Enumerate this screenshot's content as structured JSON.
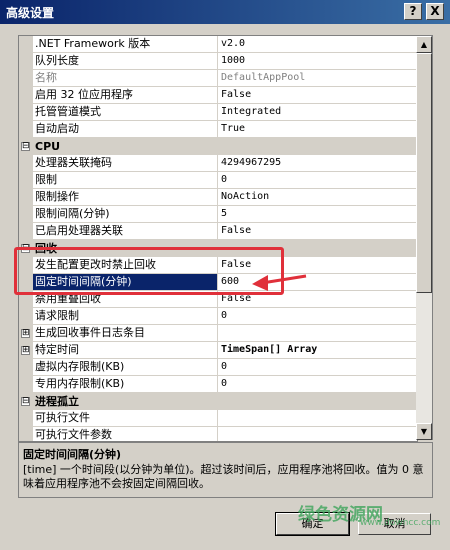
{
  "window": {
    "title": "高级设置",
    "help_glyph": "?",
    "close_glyph": "X"
  },
  "groups": {
    "general_rows": [
      {
        "name": ".NET Framework 版本",
        "value": "v2.0"
      },
      {
        "name": "队列长度",
        "value": "1000"
      },
      {
        "name": "名称",
        "value": "DefaultAppPool",
        "disabled": true
      },
      {
        "name": "启用 32 位应用程序",
        "value": "False"
      },
      {
        "name": "托管管道模式",
        "value": "Integrated"
      },
      {
        "name": "自动启动",
        "value": "True"
      }
    ],
    "cpu": {
      "label": "CPU",
      "rows": [
        {
          "name": "处理器关联掩码",
          "value": "4294967295"
        },
        {
          "name": "限制",
          "value": "0"
        },
        {
          "name": "限制操作",
          "value": "NoAction"
        },
        {
          "name": "限制间隔(分钟)",
          "value": "5"
        },
        {
          "name": "已启用处理器关联",
          "value": "False"
        }
      ]
    },
    "recycle": {
      "label": "回收",
      "rows": [
        {
          "name": "发生配置更改时禁止回收",
          "value": "False"
        },
        {
          "name": "固定时间间隔(分钟)",
          "value": "600"
        },
        {
          "name": "禁用重叠回收",
          "value": "False"
        },
        {
          "name": "请求限制",
          "value": "0"
        },
        {
          "name": "生成回收事件日志条目",
          "value": ""
        },
        {
          "name": "特定时间",
          "value": "TimeSpan[] Array"
        },
        {
          "name": "虚拟内存限制(KB)",
          "value": "0"
        },
        {
          "name": "专用内存限制(KB)",
          "value": "0"
        }
      ]
    },
    "process_orphan": {
      "label": "进程孤立",
      "rows": [
        {
          "name": "可执行文件",
          "value": ""
        },
        {
          "name": "可执行文件参数",
          "value": ""
        }
      ]
    }
  },
  "expand_glyphs": {
    "collapse": "⊟",
    "expand": "⊞"
  },
  "description": {
    "title": "固定时间间隔(分钟)",
    "text": "[time] 一个时间段(以分钟为单位)。超过该时间后，应用程序池将回收。值为 0 意味着应用程序池不会按固定间隔回收。"
  },
  "buttons": {
    "ok": "确定",
    "cancel": "取消"
  },
  "watermark": {
    "main": "绿色资源网",
    "sub": "www.downcc.com"
  },
  "colors": {
    "selection": "#0a246a",
    "annotation": "#e0303a",
    "titlebar": "#0a246a"
  }
}
